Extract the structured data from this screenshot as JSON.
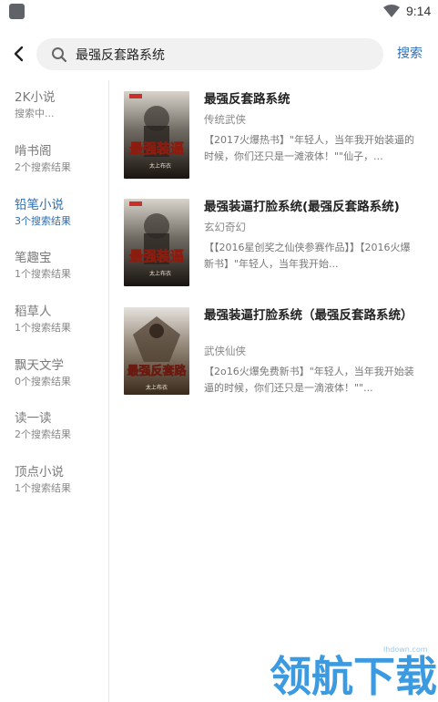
{
  "status_bar": {
    "time": "9:14"
  },
  "search": {
    "query": "最强反套路系统",
    "button_label": "搜索"
  },
  "sources": [
    {
      "name": "2K小说",
      "count": "搜索中..."
    },
    {
      "name": "啃书阁",
      "count": "2个搜索结果"
    },
    {
      "name": "铅笔小说",
      "count": "3个搜索结果",
      "active": true
    },
    {
      "name": "笔趣宝",
      "count": "1个搜索结果"
    },
    {
      "name": "稻草人",
      "count": "1个搜索结果"
    },
    {
      "name": "飘天文学",
      "count": "0个搜索结果"
    },
    {
      "name": "读一读",
      "count": "2个搜索结果"
    },
    {
      "name": "顶点小说",
      "count": "1个搜索结果"
    }
  ],
  "results": [
    {
      "title": "最强反套路系统",
      "category": "传统武侠",
      "desc": "【2017火爆热书】\"年轻人，当年我开始装逼的时候，你们还只是一滩液体！\"\"仙子，..."
    },
    {
      "title": "最强装逼打脸系统(最强反套路系统)",
      "category": "玄幻奇幻",
      "desc": "【【2016星创奖之仙侠参赛作品】】【2016火爆新书】\"年轻人，当年我开始..."
    },
    {
      "title": "最强装逼打脸系统（最强反套路系统）",
      "category": "武侠仙侠",
      "desc": "【2o16火爆免费新书】\"年轻人，当年我开始装逼的时候，你们还只是一滴液体！\"\"..."
    }
  ],
  "covers": [
    {
      "title_art": "最强装逼",
      "author_art": "太上布衣"
    },
    {
      "title_art": "最强装逼",
      "author_art": "太上布衣"
    },
    {
      "title_art": "最强反套路",
      "author_art": "太上布衣"
    }
  ],
  "colors": {
    "accent": "#2d6fb5",
    "watermark": "#3b9ae0"
  },
  "watermark": {
    "text": "领航下载",
    "url": "lhdown.com"
  }
}
